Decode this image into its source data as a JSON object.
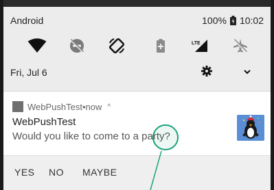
{
  "status_bar": {
    "carrier": "Android",
    "battery_percent": "100%",
    "time": "10:02"
  },
  "quick_settings": {
    "icons": [
      "wifi-icon",
      "do-not-disturb-off-icon",
      "auto-rotate-icon",
      "battery-saver-icon",
      "lte-signal-icon",
      "airplane-mode-icon"
    ],
    "date": "Fri, Jul 6"
  },
  "notification": {
    "app_name": "WebPushTest",
    "time_sep": " • ",
    "time": "now",
    "caret": "^",
    "title": "WebPushTest",
    "text": "Would you like to come to a party?",
    "actions": [
      "YES",
      "NO",
      "MAYBE"
    ]
  },
  "colors": {
    "shade_bg": "#ececec",
    "card_bg": "#ffffff",
    "touch_indicator": "#1aa07a",
    "thumb_bg": "#5a8fd6"
  }
}
